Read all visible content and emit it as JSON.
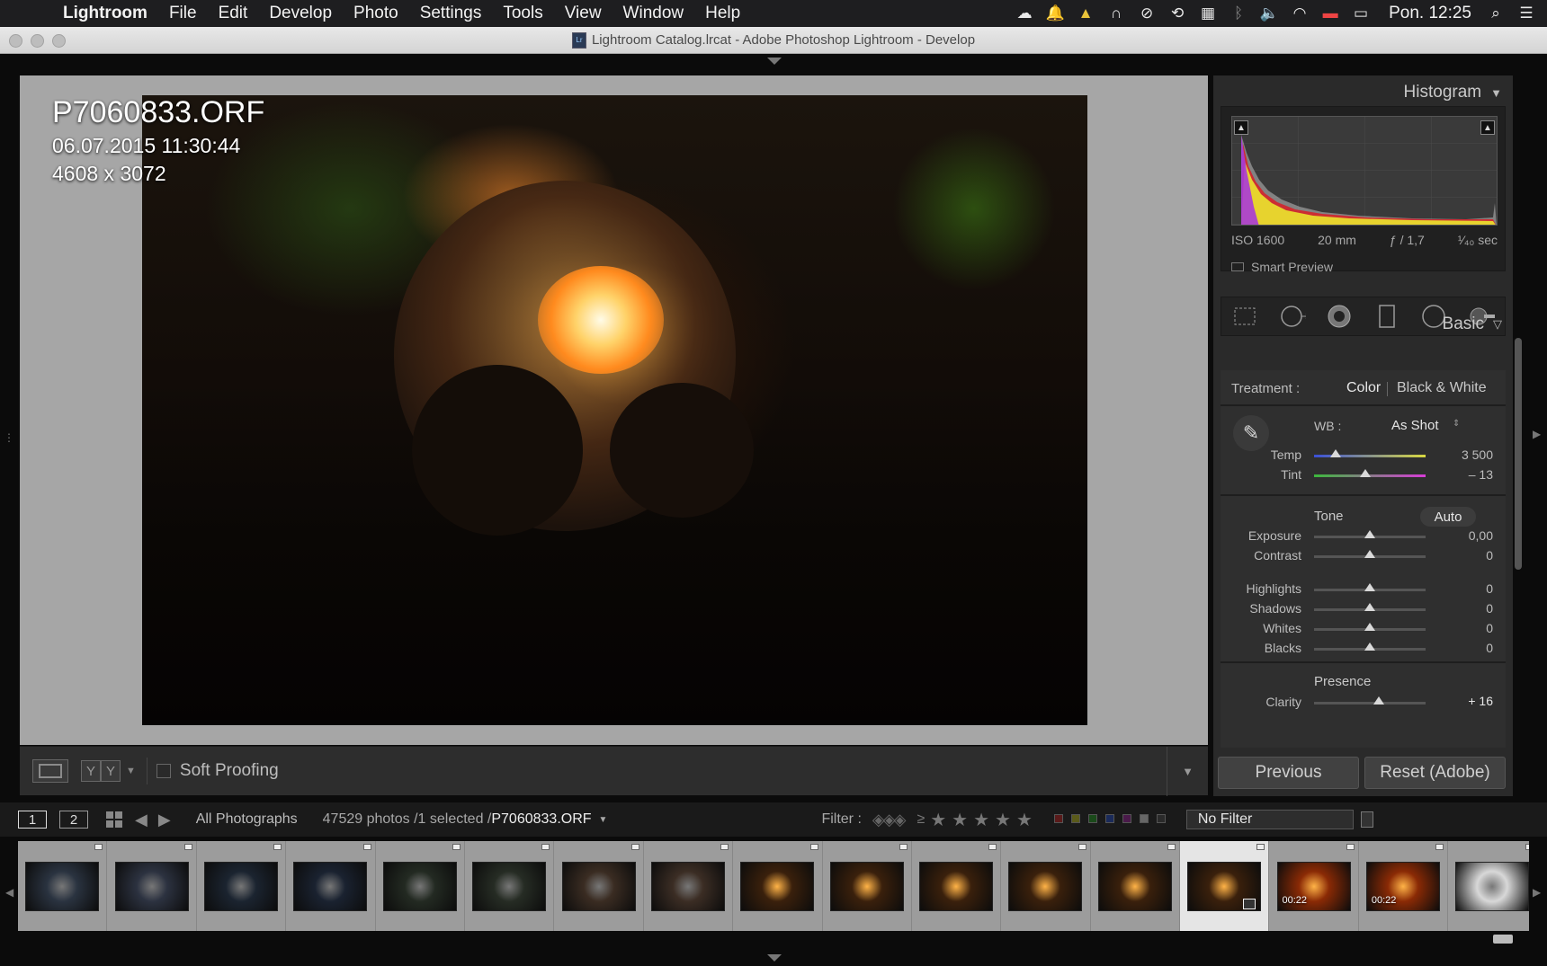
{
  "menubar": {
    "app_name": "Lightroom",
    "items": [
      "File",
      "Edit",
      "Develop",
      "Photo",
      "Settings",
      "Tools",
      "View",
      "Window",
      "Help"
    ],
    "clock": "Pon. 12:25"
  },
  "window": {
    "title": "Lightroom Catalog.lrcat - Adobe Photoshop Lightroom - Develop"
  },
  "photo_info": {
    "filename": "P7060833.ORF",
    "datetime": "06.07.2015 11:30:44",
    "dimensions": "4608 x 3072"
  },
  "toolbar": {
    "soft_proofing_label": "Soft Proofing"
  },
  "histogram": {
    "title": "Histogram",
    "iso": "ISO 1600",
    "focal": "20 mm",
    "aperture": "ƒ / 1,7",
    "shutter": "¹⁄₄₀ sec",
    "smart_preview": "Smart Preview"
  },
  "basic": {
    "title": "Basic",
    "treatment_label": "Treatment :",
    "treatment_color": "Color",
    "treatment_bw": "Black & White",
    "wb_label": "WB :",
    "wb_value": "As Shot",
    "tone_label": "Tone",
    "auto_label": "Auto",
    "presence_label": "Presence",
    "sliders": {
      "temp": {
        "label": "Temp",
        "value": "3 500",
        "position": 0.19
      },
      "tint": {
        "label": "Tint",
        "value": "– 13",
        "position": 0.46
      },
      "exposure": {
        "label": "Exposure",
        "value": "0,00",
        "position": 0.5
      },
      "contrast": {
        "label": "Contrast",
        "value": "0",
        "position": 0.5
      },
      "highlights": {
        "label": "Highlights",
        "value": "0",
        "position": 0.5
      },
      "shadows": {
        "label": "Shadows",
        "value": "0",
        "position": 0.5
      },
      "whites": {
        "label": "Whites",
        "value": "0",
        "position": 0.5
      },
      "blacks": {
        "label": "Blacks",
        "value": "0",
        "position": 0.5
      },
      "clarity": {
        "label": "Clarity",
        "value": "+ 16",
        "position": 0.58
      }
    }
  },
  "buttons": {
    "previous": "Previous",
    "reset": "Reset (Adobe)"
  },
  "filmbar": {
    "page1": "1",
    "page2": "2",
    "source": "All Photographs",
    "count": "47529 photos /1 selected /",
    "current_file": "P7060833.ORF",
    "filter_label": "Filter :",
    "rating_op": "≥",
    "stars": "★★★★★",
    "filter_value": "No Filter"
  },
  "filmstrip": {
    "thumbs": [
      {
        "color": "#2a3340"
      },
      {
        "color": "#2c3240"
      },
      {
        "color": "#1b2430"
      },
      {
        "color": "#1a2230"
      },
      {
        "color": "#232a22"
      },
      {
        "color": "#262c24"
      },
      {
        "color": "#3a2c22"
      },
      {
        "color": "#3b2d24"
      },
      {
        "color": "#3a200c"
      },
      {
        "color": "#3a200c"
      },
      {
        "color": "#3a200c"
      },
      {
        "color": "#3a200c"
      },
      {
        "color": "#3a200c"
      },
      {
        "color": "#3a200c"
      },
      {
        "color": "#8a2a05"
      },
      {
        "color": "#8a2a05"
      },
      {
        "color": "#d8d8d8"
      }
    ],
    "video_time_1": "00:22",
    "video_time_2": "00:22"
  }
}
